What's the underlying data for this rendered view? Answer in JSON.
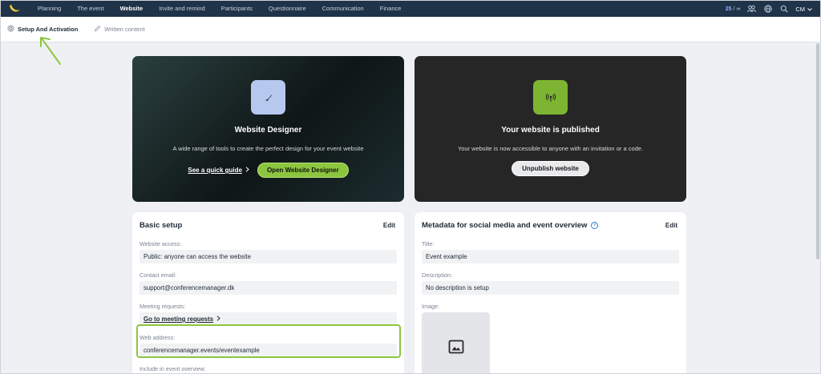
{
  "nav": {
    "items": [
      "Planning",
      "The event",
      "Website",
      "Invite and remind",
      "Participants",
      "Questionnaire",
      "Communication",
      "Finance"
    ],
    "active": "Website",
    "counter_used": "25",
    "counter_limit": " / ∞",
    "user_initials": "CM"
  },
  "subnav": {
    "setup_label": "Setup And Activation",
    "written_label": "Written content"
  },
  "designer": {
    "title": "Website Designer",
    "description": "A wide range of tools to create the perfect design for your event website",
    "guide_label": "See a quick guide",
    "open_label": "Open Website Designer"
  },
  "published": {
    "title": "Your website is published",
    "description": "Your website is now accessible to anyone with an invitation or a code.",
    "unpublish_label": "Unpublish website"
  },
  "basic_setup": {
    "title": "Basic setup",
    "edit_label": "Edit",
    "website_access_label": "Website access:",
    "website_access_value": "Public: anyone can access the website",
    "contact_email_label": "Contact email:",
    "contact_email_value": "support@conferencemanager.dk",
    "meeting_requests_label": "Meeting requests:",
    "meeting_requests_link": "Go to meeting requests",
    "web_address_label": "Web address:",
    "web_address_value": "conferencemanager.events/eventexample",
    "include_overview_label": "Include in event overview:"
  },
  "metadata": {
    "title": "Metadata for social media and event overview",
    "edit_label": "Edit",
    "title_label": "Title:",
    "title_value": "Event example",
    "description_label": "Description:",
    "description_value": "No description is setup",
    "image_label": "Image:"
  },
  "colors": {
    "nav_bg": "#1f3349",
    "accent_green": "#8cc63f",
    "designer_icon_bg": "#b7c8ef",
    "published_icon_bg": "#7db532"
  }
}
